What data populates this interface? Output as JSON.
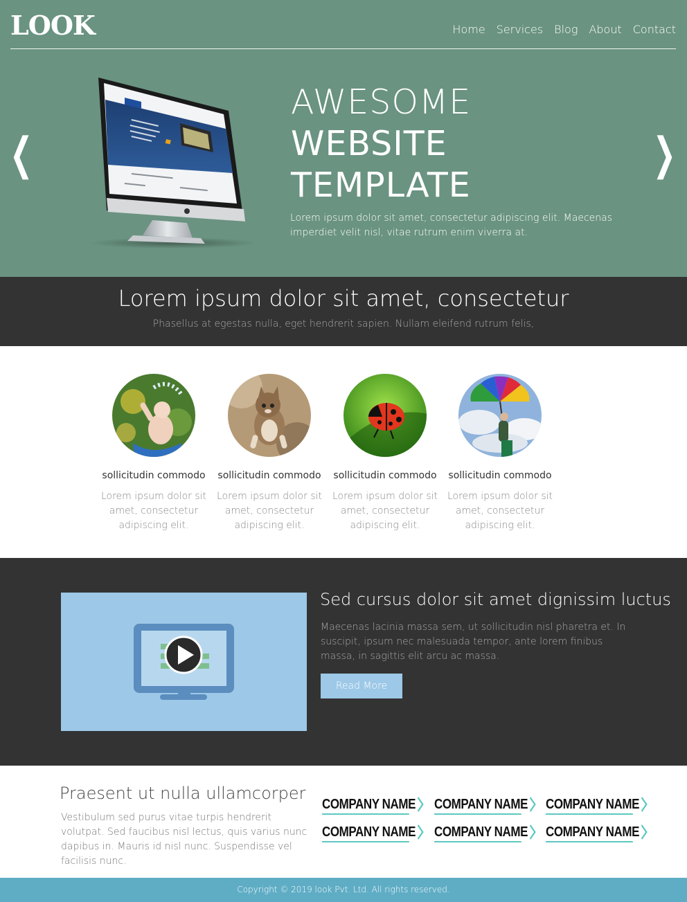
{
  "brand": {
    "logo": "LOOK"
  },
  "nav": {
    "items": [
      "Home",
      "Services",
      "Blog",
      "About",
      "Contact"
    ]
  },
  "hero": {
    "title_line1": "AWESOME",
    "title_line2": "WEBSITE",
    "title_line3": "TEMPLATE",
    "text": "Lorem ipsum dolor sit amet, consectetur adipiscing elit. Maecenas imperdiet velit nisl, vitae rutrum enim viverra at.",
    "prev": "❮",
    "next": "❯"
  },
  "band": {
    "title": "Lorem ipsum dolor sit amet, consectetur",
    "subtitle": "Phasellus at egestas nulla, eget hendrerit sapien. Nullam eleifend rutrum felis,"
  },
  "features": [
    {
      "title": "sollicitudin commodo",
      "text": "Lorem ipsum dolor sit amet, consectetur adipiscing elit.",
      "image": "child-splashing-water"
    },
    {
      "title": "sollicitudin commodo",
      "text": "Lorem ipsum dolor sit amet, consectetur adipiscing elit.",
      "image": "jumping-kitten"
    },
    {
      "title": "sollicitudin commodo",
      "text": "Lorem ipsum dolor sit amet, consectetur adipiscing elit.",
      "image": "ladybug-on-leaf"
    },
    {
      "title": "sollicitudin commodo",
      "text": "Lorem ipsum dolor sit amet, consectetur adipiscing elit.",
      "image": "rainbow-umbrella"
    }
  ],
  "video": {
    "title": "Sed cursus dolor sit amet dignissim luctus",
    "text": "Maecenas lacinia massa sem, ut sollicitudin nisl pharetra et. In suscipit, ipsum nec malesuada tempor, ante lorem finibus massa, in sagittis elit arcu ac massa.",
    "button": "Read More"
  },
  "bottom": {
    "title": "Praesent ut nulla ullamcorper",
    "text": "Vestibulum sed purus vitae turpis hendrerit volutpat. Sed faucibus nisl lectus, quis varius nunc dapibus in. Mauris id nisl nunc. Suspendisse vel facilisis nunc.",
    "companies": [
      "COMPANY NAME",
      "COMPANY NAME",
      "COMPANY NAME",
      "COMPANY NAME",
      "COMPANY NAME",
      "COMPANY NAME"
    ]
  },
  "footer": {
    "copyright": "Copyright © 2019 look Pvt. Ltd. All rights reserved."
  },
  "colors": {
    "hero": "#6a9381",
    "dark": "#333333",
    "accent_blue": "#9dc8e7",
    "footer": "#5fadc5",
    "company_underline": "#5cc8c0"
  }
}
